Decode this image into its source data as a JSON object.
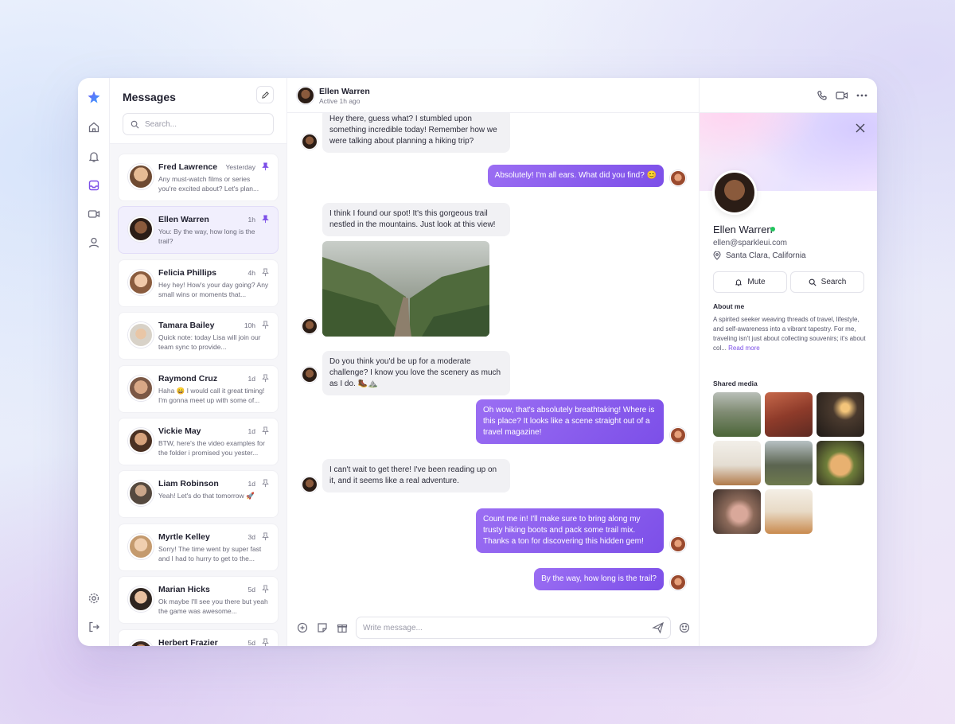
{
  "app": {
    "nav": [
      "logo-icon",
      "home-icon",
      "bell-icon",
      "inbox-icon",
      "video-icon",
      "user-icon",
      "settings-icon",
      "logout-icon"
    ]
  },
  "conversations": {
    "title": "Messages",
    "search_placeholder": "Search...",
    "items": [
      {
        "name": "Fred Lawrence",
        "time": "Yesterday",
        "preview": "Any must-watch films or series you're excited about? Let's plan...",
        "pinned": true
      },
      {
        "name": "Ellen Warren",
        "time": "1h",
        "preview": "You: By the way, how long is the trail?",
        "pinned": true,
        "active": true
      },
      {
        "name": "Felicia Phillips",
        "time": "4h",
        "preview": "Hey hey! How's your day going? Any small wins or moments that...",
        "pinned": false
      },
      {
        "name": "Tamara Bailey",
        "time": "10h",
        "preview": "Quick note: today Lisa will join our team sync to provide...",
        "pinned": false
      },
      {
        "name": "Raymond Cruz",
        "time": "1d",
        "preview": "Haha 😄 I would call it great timing! I'm gonna meet up with some of...",
        "pinned": false
      },
      {
        "name": "Vickie May",
        "time": "1d",
        "preview": "BTW, here's the video examples for the folder i promised you yester...",
        "pinned": false
      },
      {
        "name": "Liam Robinson",
        "time": "1d",
        "preview": "Yeah! Let's do that tomorrow 🚀",
        "pinned": false
      },
      {
        "name": "Myrtle Kelley",
        "time": "3d",
        "preview": "Sorry! The time went by super fast and I had to hurry to get to the...",
        "pinned": false
      },
      {
        "name": "Marian Hicks",
        "time": "5d",
        "preview": "Ok maybe I'll see you there but yeah the game was awesome...",
        "pinned": false
      },
      {
        "name": "Herbert Frazier",
        "time": "5d",
        "preview": "",
        "pinned": false
      }
    ]
  },
  "chat": {
    "contact_name": "Ellen Warren",
    "contact_status": "Active 1h ago",
    "messages": [
      {
        "from": "them",
        "text": "Hey there, guess what? I stumbled upon something incredible today! Remember how we were talking about planning a hiking trip?"
      },
      {
        "from": "me",
        "text": "Absolutely! I'm all ears. What did you find? 😊"
      },
      {
        "from": "them",
        "text": "I think I found our spot! It's this gorgeous trail nestled in the mountains. Just look at this view!"
      },
      {
        "from": "them",
        "image": "misty-mountain-trail"
      },
      {
        "from": "them",
        "text": "Do you think you'd be up for a moderate challenge? I know you love the scenery as much as I do. 🥾⛰️"
      },
      {
        "from": "me",
        "text": "Oh wow, that's absolutely breathtaking! Where is this place? It looks like a scene straight out of a travel magazine!"
      },
      {
        "from": "them",
        "text": "I can't wait to get there! I've been reading up on it, and it seems like a real adventure."
      },
      {
        "from": "me",
        "text": "Count me in! I'll make sure to bring along my trusty hiking boots and pack some trail mix. Thanks a ton for discovering this hidden gem!"
      },
      {
        "from": "me",
        "text": "By the way, how long is the trail?"
      }
    ],
    "composer_placeholder": "Write message..."
  },
  "profile": {
    "name": "Ellen Warren",
    "email": "ellen@sparkleui.com",
    "location": "Santa Clara, California",
    "mute_label": "Mute",
    "search_label": "Search",
    "about_title": "About me",
    "about_text": "A spirited seeker weaving threads of travel, lifestyle, and self-awareness into a vibrant tapestry. For me, traveling isn't just about collecting souvenirs; it's about col...",
    "read_more": "Read more",
    "media_title": "Shared media",
    "media": [
      "misty-trail",
      "red-canyon",
      "restaurant-night",
      "living-room",
      "rock-spires",
      "salmon-dish",
      "tea-cake",
      "cafe-interior"
    ]
  },
  "colors": {
    "accent": "#7c4fe8",
    "accent_light": "#9b6ef3",
    "online": "#22c55e"
  }
}
